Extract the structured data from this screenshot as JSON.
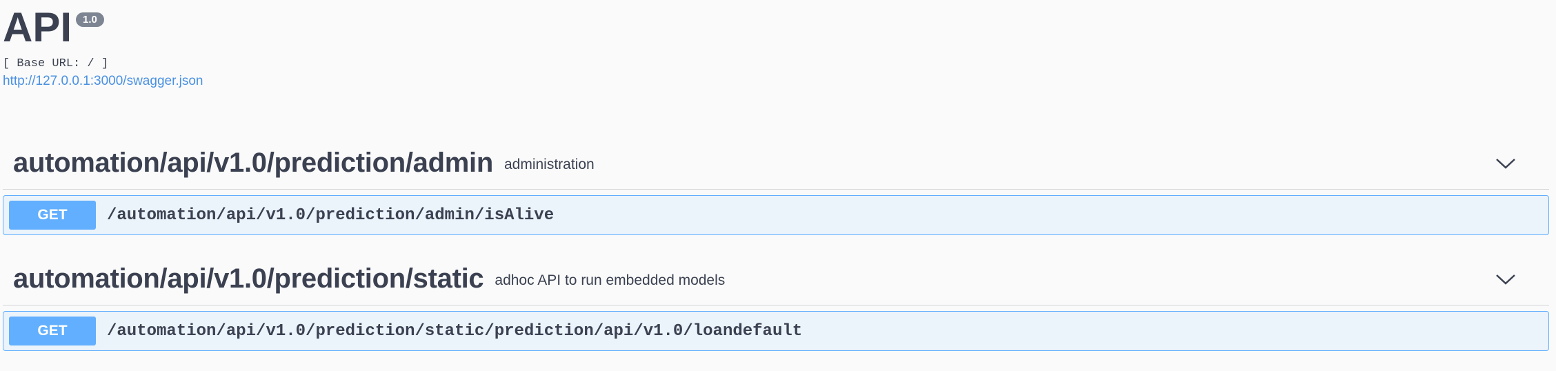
{
  "info": {
    "title": "API",
    "version": "1.0",
    "base_url": "[ Base URL: / ]",
    "spec_link": "http://127.0.0.1:3000/swagger.json"
  },
  "tags": [
    {
      "name": "automation/api/v1.0/prediction/admin",
      "description": "administration",
      "chevron_icon": "chevron-down-icon",
      "operations": [
        {
          "method": "GET",
          "path": "/automation/api/v1.0/prediction/admin/isAlive"
        }
      ]
    },
    {
      "name": "automation/api/v1.0/prediction/static",
      "description": "adhoc API to run embedded models",
      "chevron_icon": "chevron-down-icon",
      "operations": [
        {
          "method": "GET",
          "path": "/automation/api/v1.0/prediction/static/prediction/api/v1.0/loandefault"
        }
      ]
    }
  ],
  "colors": {
    "get_accent": "#61affe",
    "get_background": "#ebf3fb",
    "link": "#4990e2",
    "text": "#3b4151",
    "version_badge": "#7d8492"
  }
}
